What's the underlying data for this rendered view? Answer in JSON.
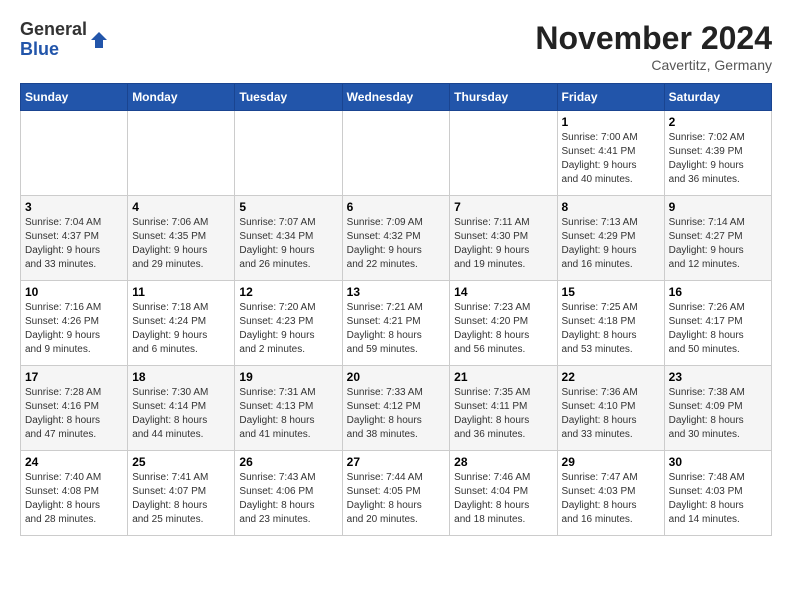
{
  "logo": {
    "general": "General",
    "blue": "Blue"
  },
  "title": "November 2024",
  "location": "Cavertitz, Germany",
  "days_header": [
    "Sunday",
    "Monday",
    "Tuesday",
    "Wednesday",
    "Thursday",
    "Friday",
    "Saturday"
  ],
  "weeks": [
    [
      {
        "day": "",
        "info": ""
      },
      {
        "day": "",
        "info": ""
      },
      {
        "day": "",
        "info": ""
      },
      {
        "day": "",
        "info": ""
      },
      {
        "day": "",
        "info": ""
      },
      {
        "day": "1",
        "info": "Sunrise: 7:00 AM\nSunset: 4:41 PM\nDaylight: 9 hours\nand 40 minutes."
      },
      {
        "day": "2",
        "info": "Sunrise: 7:02 AM\nSunset: 4:39 PM\nDaylight: 9 hours\nand 36 minutes."
      }
    ],
    [
      {
        "day": "3",
        "info": "Sunrise: 7:04 AM\nSunset: 4:37 PM\nDaylight: 9 hours\nand 33 minutes."
      },
      {
        "day": "4",
        "info": "Sunrise: 7:06 AM\nSunset: 4:35 PM\nDaylight: 9 hours\nand 29 minutes."
      },
      {
        "day": "5",
        "info": "Sunrise: 7:07 AM\nSunset: 4:34 PM\nDaylight: 9 hours\nand 26 minutes."
      },
      {
        "day": "6",
        "info": "Sunrise: 7:09 AM\nSunset: 4:32 PM\nDaylight: 9 hours\nand 22 minutes."
      },
      {
        "day": "7",
        "info": "Sunrise: 7:11 AM\nSunset: 4:30 PM\nDaylight: 9 hours\nand 19 minutes."
      },
      {
        "day": "8",
        "info": "Sunrise: 7:13 AM\nSunset: 4:29 PM\nDaylight: 9 hours\nand 16 minutes."
      },
      {
        "day": "9",
        "info": "Sunrise: 7:14 AM\nSunset: 4:27 PM\nDaylight: 9 hours\nand 12 minutes."
      }
    ],
    [
      {
        "day": "10",
        "info": "Sunrise: 7:16 AM\nSunset: 4:26 PM\nDaylight: 9 hours\nand 9 minutes."
      },
      {
        "day": "11",
        "info": "Sunrise: 7:18 AM\nSunset: 4:24 PM\nDaylight: 9 hours\nand 6 minutes."
      },
      {
        "day": "12",
        "info": "Sunrise: 7:20 AM\nSunset: 4:23 PM\nDaylight: 9 hours\nand 2 minutes."
      },
      {
        "day": "13",
        "info": "Sunrise: 7:21 AM\nSunset: 4:21 PM\nDaylight: 8 hours\nand 59 minutes."
      },
      {
        "day": "14",
        "info": "Sunrise: 7:23 AM\nSunset: 4:20 PM\nDaylight: 8 hours\nand 56 minutes."
      },
      {
        "day": "15",
        "info": "Sunrise: 7:25 AM\nSunset: 4:18 PM\nDaylight: 8 hours\nand 53 minutes."
      },
      {
        "day": "16",
        "info": "Sunrise: 7:26 AM\nSunset: 4:17 PM\nDaylight: 8 hours\nand 50 minutes."
      }
    ],
    [
      {
        "day": "17",
        "info": "Sunrise: 7:28 AM\nSunset: 4:16 PM\nDaylight: 8 hours\nand 47 minutes."
      },
      {
        "day": "18",
        "info": "Sunrise: 7:30 AM\nSunset: 4:14 PM\nDaylight: 8 hours\nand 44 minutes."
      },
      {
        "day": "19",
        "info": "Sunrise: 7:31 AM\nSunset: 4:13 PM\nDaylight: 8 hours\nand 41 minutes."
      },
      {
        "day": "20",
        "info": "Sunrise: 7:33 AM\nSunset: 4:12 PM\nDaylight: 8 hours\nand 38 minutes."
      },
      {
        "day": "21",
        "info": "Sunrise: 7:35 AM\nSunset: 4:11 PM\nDaylight: 8 hours\nand 36 minutes."
      },
      {
        "day": "22",
        "info": "Sunrise: 7:36 AM\nSunset: 4:10 PM\nDaylight: 8 hours\nand 33 minutes."
      },
      {
        "day": "23",
        "info": "Sunrise: 7:38 AM\nSunset: 4:09 PM\nDaylight: 8 hours\nand 30 minutes."
      }
    ],
    [
      {
        "day": "24",
        "info": "Sunrise: 7:40 AM\nSunset: 4:08 PM\nDaylight: 8 hours\nand 28 minutes."
      },
      {
        "day": "25",
        "info": "Sunrise: 7:41 AM\nSunset: 4:07 PM\nDaylight: 8 hours\nand 25 minutes."
      },
      {
        "day": "26",
        "info": "Sunrise: 7:43 AM\nSunset: 4:06 PM\nDaylight: 8 hours\nand 23 minutes."
      },
      {
        "day": "27",
        "info": "Sunrise: 7:44 AM\nSunset: 4:05 PM\nDaylight: 8 hours\nand 20 minutes."
      },
      {
        "day": "28",
        "info": "Sunrise: 7:46 AM\nSunset: 4:04 PM\nDaylight: 8 hours\nand 18 minutes."
      },
      {
        "day": "29",
        "info": "Sunrise: 7:47 AM\nSunset: 4:03 PM\nDaylight: 8 hours\nand 16 minutes."
      },
      {
        "day": "30",
        "info": "Sunrise: 7:48 AM\nSunset: 4:03 PM\nDaylight: 8 hours\nand 14 minutes."
      }
    ]
  ]
}
